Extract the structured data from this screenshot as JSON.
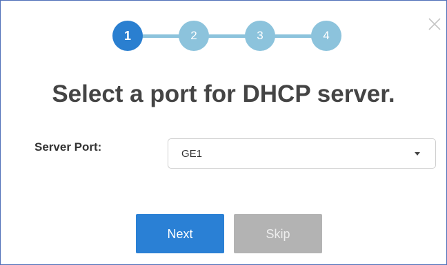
{
  "wizard": {
    "steps": [
      {
        "label": "1",
        "state": "active"
      },
      {
        "label": "2",
        "state": "pending"
      },
      {
        "label": "3",
        "state": "pending"
      },
      {
        "label": "4",
        "state": "pending"
      }
    ],
    "current_step": 1
  },
  "title": "Select a port for DHCP server.",
  "form": {
    "server_port_label": "Server Port:",
    "server_port_value": "GE1"
  },
  "buttons": {
    "next_label": "Next",
    "skip_label": "Skip"
  },
  "icons": {
    "close": "close-icon",
    "dropdown": "chevron-down-icon"
  },
  "colors": {
    "active_step": "#2a7fd0",
    "pending_step": "#8cc3dc",
    "primary_button": "#2a80d5",
    "disabled_button": "#b3b3b3",
    "border": "#4f6fb8"
  }
}
